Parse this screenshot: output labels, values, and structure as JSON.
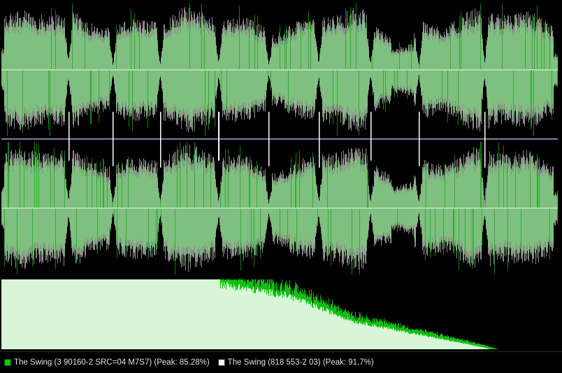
{
  "colors": {
    "background": "#000000",
    "waveform_a": "#7fbf7f",
    "waveform_a_spikes": "#18a818",
    "waveform_b": "#8a8a8a",
    "center_line": "#c8e6c8",
    "divider": "#7d7d9a",
    "track_marks": "#ffffff",
    "spectrum_fill": "#d8f5d8",
    "spectrum_overlay": "#10c010",
    "legend_swatch_a": "#00d000",
    "legend_swatch_b": "#ffffff"
  },
  "track_boundaries": [
    0.12,
    0.2,
    0.285,
    0.39,
    0.48,
    0.57,
    0.663,
    0.75,
    0.868
  ],
  "legend": [
    {
      "label": "The Swing (3 90160-2 SRC=04 M7S7) (Peak: 85.28%)",
      "swatch": "#00d000"
    },
    {
      "label": "The Swing (818 553-2 03) (Peak: 91.7%)",
      "swatch": "#ffffff"
    }
  ]
}
